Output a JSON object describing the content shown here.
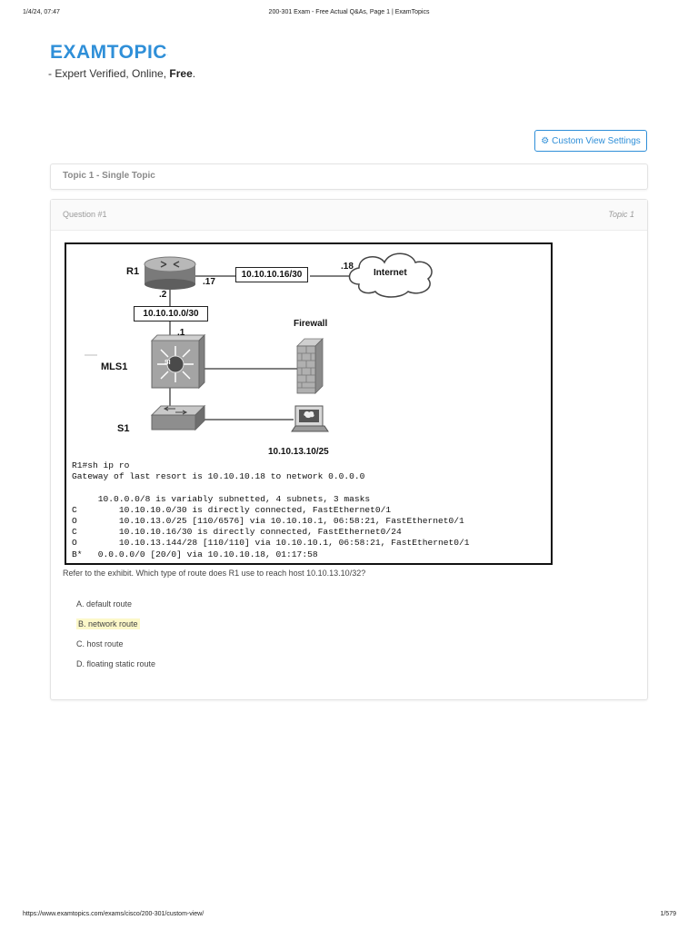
{
  "print_header": {
    "datetime": "1/4/24, 07:47",
    "title": "200-301 Exam - Free Actual Q&As, Page 1 | ExamTopics"
  },
  "brand": {
    "logo_text": "EXAMTOPICS",
    "tagline_prefix": "- Expert Verified, Online, ",
    "tagline_bold": "Free",
    "tagline_suffix": "."
  },
  "custom_view_button": {
    "label": "Custom View Settings",
    "icon": "gear-icon"
  },
  "topic_card": {
    "title": "Topic 1 - Single Topic"
  },
  "question": {
    "number_label": "Question #1",
    "topic_label": "Topic 1",
    "exhibit": {
      "r1_label": "R1",
      "r1_wan_ip": ".17",
      "r1_lan_ip": ".2",
      "wan_subnet": "10.10.10.16/30",
      "internet_ip": ".18",
      "internet_label": "Internet",
      "lan_subnet": "10.10.10.0/30",
      "mls1_ip": ".1",
      "mls1_label": "MLS1",
      "mls1_badge": "SI",
      "firewall_label": "Firewall",
      "s1_label": "S1",
      "host_label": "10.10.13.10/25",
      "console_lines": [
        "R1#sh ip ro",
        "Gateway of last resort is 10.10.10.18 to network 0.0.0.0",
        "",
        "     10.0.0.0/8 is variably subnetted, 4 subnets, 3 masks",
        "C        10.10.10.0/30 is directly connected, FastEthernet0/1",
        "O        10.10.13.0/25 [110/6576] via 10.10.10.1, 06:58:21, FastEthernet0/1",
        "C        10.10.10.16/30 is directly connected, FastEthernet0/24",
        "O        10.10.13.144/28 [110/110] via 10.10.10.1, 06:58:21, FastEthernet0/1",
        "B*   0.0.0.0/0 [20/0] via 10.10.10.18, 01:17:58"
      ]
    },
    "text": "Refer to the exhibit. Which type of route does R1 use to reach host 10.10.13.10/32?",
    "choices": [
      {
        "label": "A. default route",
        "highlighted": false
      },
      {
        "label": "B. network route",
        "highlighted": true
      },
      {
        "label": "C. host route",
        "highlighted": false
      },
      {
        "label": "D. floating static route",
        "highlighted": false
      }
    ]
  },
  "print_footer": {
    "url": "https://www.examtopics.com/exams/cisco/200-301/custom-view/",
    "page": "1/579"
  },
  "colors": {
    "brand_blue": "#2f8fd8",
    "highlight": "#fcf8c9"
  }
}
